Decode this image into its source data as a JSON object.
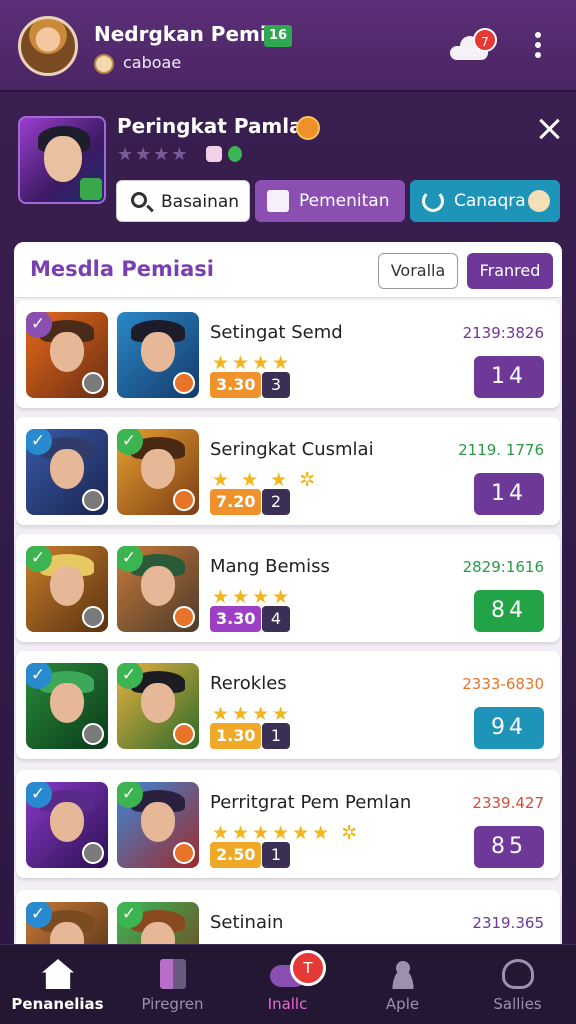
{
  "header": {
    "username": "Nedrgkan Pemiia",
    "level": "16",
    "currency": "caboae",
    "notifications": "7"
  },
  "board": {
    "title": "Peringkat Pamlar",
    "search_label": "Basainan",
    "filter_label": "Pemenitan",
    "share_label": "Canaqra"
  },
  "list": {
    "title": "Mesdla Pemiasi",
    "tab_a": "Voralla",
    "tab_b": "Franred"
  },
  "rows": [
    {
      "name": "Setingat Semd",
      "stars": "★★★★",
      "score": "3.30",
      "count": "3",
      "time": "2139:3826",
      "rank": "14",
      "rank_color": "#6e3898",
      "score_color": "#f0922b",
      "time_color": "#6e3898",
      "check_color": "#8a4fb0"
    },
    {
      "name": "Seringkat Cusmlai",
      "stars": "★ ★ ★ ✲",
      "score": "7.20",
      "count": "2",
      "time": "2119. 1776",
      "rank": "14",
      "rank_color": "#6e3898",
      "score_color": "#f0922b",
      "time_color": "#2a9a44",
      "check_color": "#2a8ad0"
    },
    {
      "name": "Mang Bemiss",
      "stars": "★★★★",
      "score": "3.30",
      "count": "4",
      "time": "2829:1616",
      "rank": "84",
      "rank_color": "#22a346",
      "score_color": "#9c3fc4",
      "time_color": "#2a9a44",
      "check_color": "#3cb451"
    },
    {
      "name": "Rerokles",
      "stars": "★★★★",
      "score": "1.30",
      "count": "1",
      "time": "2333-6830",
      "rank": "94",
      "rank_color": "#1e95b8",
      "score_color": "#f0a829",
      "time_color": "#e8742a",
      "check_color": "#2a8ad0"
    },
    {
      "name": "Perritgrat Pem Pemlan",
      "stars": "★★★★★★ ✲",
      "score": "2.50",
      "count": "1",
      "time": "2339.427",
      "rank": "85",
      "rank_color": "#6e3898",
      "score_color": "#f0a829",
      "time_color": "#d84a3a",
      "check_color": "#2a8ad0"
    },
    {
      "name": "Setinain",
      "stars": "★★★",
      "score": "",
      "count": "",
      "time": "2319.365",
      "rank": "",
      "rank_color": "#1e95b8",
      "score_color": "#f0a829",
      "time_color": "#6e3898",
      "check_color": "#2a8ad0"
    }
  ],
  "nav": [
    {
      "label": "Penanelias",
      "icon": "home-icon"
    },
    {
      "label": "Piregren",
      "icon": "progress-icon"
    },
    {
      "label": "Inallc",
      "icon": "game-icon",
      "badge": "T"
    },
    {
      "label": "Aple",
      "icon": "person-icon"
    },
    {
      "label": "Sallies",
      "icon": "user-icon"
    }
  ],
  "colors": {
    "accent": "#6e3898",
    "header_bg": "#5c2f78",
    "teal": "#1e95b8",
    "green": "#22a346"
  }
}
